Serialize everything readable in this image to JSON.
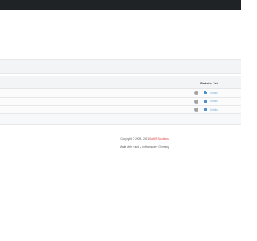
{
  "table": {
    "column_header": "Statistic-Zeit",
    "rows": [
      {
        "status": "inactive",
        "link_label": "Details"
      },
      {
        "status": "inactive",
        "link_label": "Details"
      },
      {
        "status": "inactive",
        "link_label": "Details"
      }
    ]
  },
  "footer": {
    "copyright_prefix": "Copyright © 2009 - 2021",
    "brand": "SwiftIT Solutions",
    "made_with": "Made with",
    "heart": "♥",
    "and": "and",
    "cup": "☕",
    "suffix": "in Hannover · Germany"
  },
  "colors": {
    "topbar": "#1f2326",
    "link": "#7aaee0",
    "folder": "#4a8fd0",
    "brand": "#dd3333"
  }
}
